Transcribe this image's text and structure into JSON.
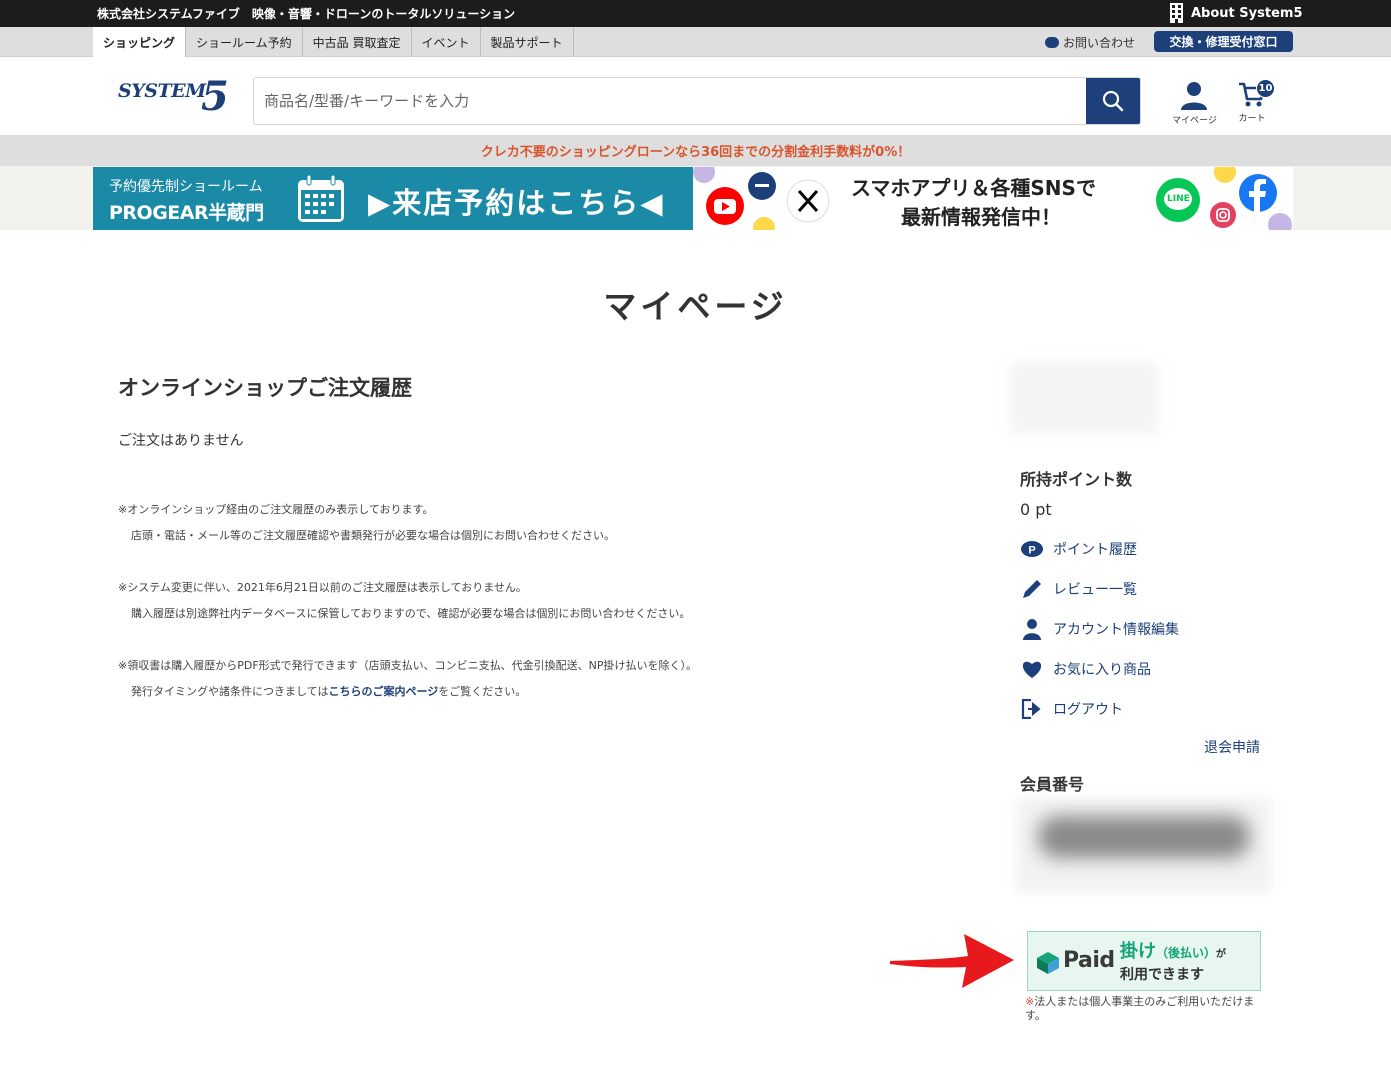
{
  "topbar": {
    "tagline": "株式会社システムファイブ　映像・音響・ドローンのトータルソリューション",
    "about": "About System5"
  },
  "nav": {
    "tabs": [
      {
        "label": "ショッピング",
        "active": true
      },
      {
        "label": "ショールーム予約",
        "active": false
      },
      {
        "label": "中古品 買取査定",
        "active": false
      },
      {
        "label": "イベント",
        "active": false
      },
      {
        "label": "製品サポート",
        "active": false
      }
    ],
    "contact": "お問い合わせ",
    "repair": "交換・修理受付窓口"
  },
  "header": {
    "logo_word": "SYSTEM",
    "logo_five": "5",
    "search_placeholder": "商品名/型番/キーワードを入力",
    "mypage_label": "マイページ",
    "cart_label": "カート",
    "cart_count": "10"
  },
  "promo": "クレカ不要のショッピングローンなら36回までの分割金利手数料が0%！",
  "banners": {
    "showroom_line1": "予約優先制ショールーム",
    "showroom_line2": "PROGEAR半蔵門",
    "showroom_cta": "▶来店予約はこちら◀",
    "sns_line1": "スマホアプリ＆各種SNSで",
    "sns_line2": "最新情報発信中！",
    "line_label": "LINE"
  },
  "page_title": "マイページ",
  "orders": {
    "title": "オンラインショップご注文履歴",
    "empty": "ご注文はありません",
    "notes": [
      {
        "line1": "※オンラインショップ経由のご注文履歴のみ表示しております。",
        "line2": "店頭・電話・メール等のご注文履歴確認や書類発行が必要な場合は個別にお問い合わせください。"
      },
      {
        "line1": "※システム変更に伴い、2021年6月21日以前のご注文履歴は表示しておりません。",
        "line2": "購入履歴は別途弊社内データベースに保管しておりますので、確認が必要な場合は個別にお問い合わせください。"
      },
      {
        "line1": "※領収書は購入履歴からPDF形式で発行できます（店頭支払い、コンビニ支払、代金引換配送、NP掛け払いを除く）。",
        "line2_pre": "発行タイミングや諸条件につきましては",
        "line2_link": "こちらのご案内ページ",
        "line2_post": "をご覧ください。"
      }
    ]
  },
  "sidebar": {
    "points_title": "所持ポイント数",
    "points_value": "0 pt",
    "links": [
      {
        "label": "ポイント履歴",
        "icon": "point-icon"
      },
      {
        "label": "レビュー一覧",
        "icon": "pencil-icon"
      },
      {
        "label": "アカウント情報編集",
        "icon": "person-icon"
      },
      {
        "label": "お気に入り商品",
        "icon": "heart-icon"
      },
      {
        "label": "ログアウト",
        "icon": "logout-icon"
      }
    ],
    "withdraw": "退会申請",
    "member_title": "会員番号"
  },
  "paid": {
    "logo": "Paid",
    "line1": "掛け",
    "line1_paren": "（後払い）",
    "line1_ga": "が",
    "line2": "利用できます",
    "note_mark": "※",
    "note": "法人または個人事業主のみご利用いただけます。"
  },
  "colors": {
    "brand_navy": "#1d3f7a",
    "promo_orange": "#d9542b",
    "showroom_teal": "#1b8aa7",
    "paid_green": "#16a379",
    "arrow_red": "#e8191c"
  }
}
